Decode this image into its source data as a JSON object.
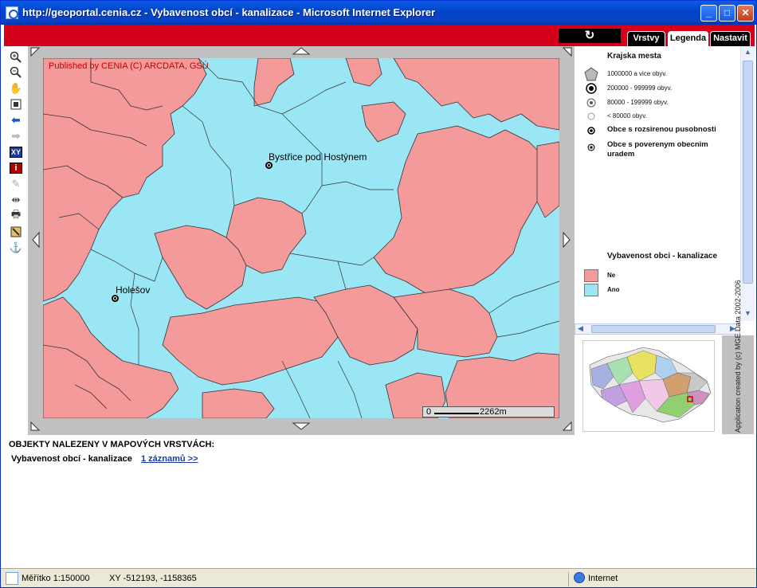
{
  "window": {
    "title": "http://geoportal.cenia.cz - Vybavenost obcí - kanalizace - Microsoft Internet Explorer",
    "controls": [
      "minimize",
      "maximize",
      "close"
    ]
  },
  "header": {
    "refresh_icon": "refresh-icon",
    "tabs": [
      {
        "label": "Vrstvy",
        "active": false
      },
      {
        "label": "Legenda",
        "active": true
      },
      {
        "label": "Nastavit",
        "active": false
      }
    ]
  },
  "toolbar": {
    "tools": [
      "zoom-in-icon",
      "zoom-out-icon",
      "pan-hand-icon",
      "full-extent-icon",
      "back-arrow-icon",
      "forward-arrow-icon",
      "xy-icon",
      "info-icon",
      "eraser-icon",
      "measure-icon",
      "print-icon",
      "export-icon",
      "anchor-icon"
    ],
    "xy_label": "XY",
    "info_label": "i"
  },
  "map": {
    "publisher": "Published by CENIA   (C) ARCDATA, GSÚ",
    "cities": [
      {
        "name": "Bystřice pod Hostýnem"
      },
      {
        "name": "Holešov"
      }
    ],
    "scale_start": "0",
    "scale_distance": "2262m",
    "colors": {
      "ne": "#f59a9a",
      "ano": "#9be6f5",
      "border": "#333333"
    }
  },
  "legend": {
    "group1_title": "Krajska mesta",
    "group1_items": [
      "1000000 a vice obyv.",
      "200000 - 999999 obyv.",
      "80000 - 199999 obyv.",
      "< 80000 obyv."
    ],
    "item_rozsirenou": "Obce s rozsirenou pusobnosti",
    "item_poverenym": "Obce s poverenym obecnim uradem",
    "group2_title": "Vybavenost obci - kanalizace",
    "group2_items": [
      {
        "label": "Ne",
        "color": "#f59a9a"
      },
      {
        "label": "Ano",
        "color": "#9be6f5"
      }
    ]
  },
  "credit": "Application created by (c) MGE Data 2002-2006",
  "results": {
    "heading": "OBJEKTY NALEZENY V MAPOVÝCH VRSTVÁCH:",
    "layer": "Vybavenost obcí - kanalizace",
    "link": "1 záznamů >>"
  },
  "statusbar": {
    "scale": "Měřítko 1:150000",
    "xy": "XY -512193, -1158365",
    "zone": "Internet"
  }
}
